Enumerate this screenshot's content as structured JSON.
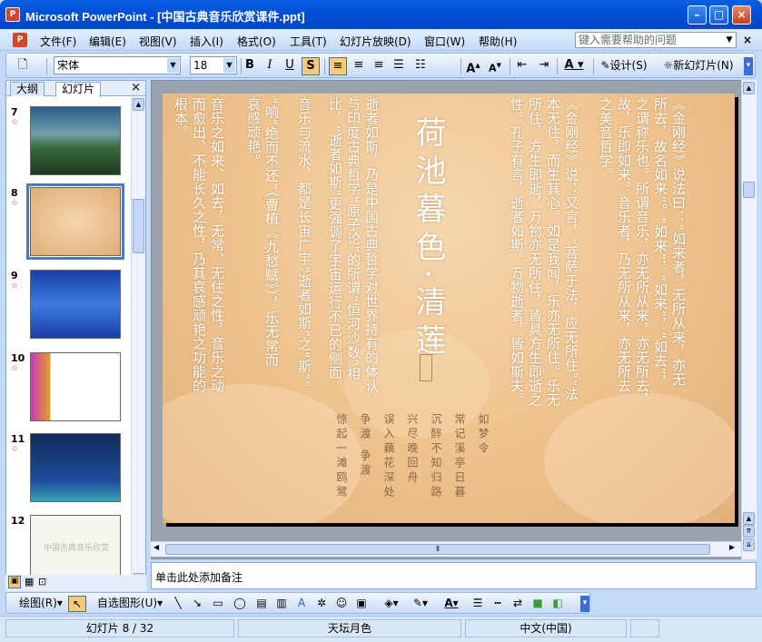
{
  "window": {
    "title": "Microsoft PowerPoint - [中国古典音乐欣赏课件.ppt]",
    "minimize": "–",
    "maximize": "□",
    "close": "×"
  },
  "menu": {
    "items": [
      "文件(F)",
      "编辑(E)",
      "视图(V)",
      "插入(I)",
      "格式(O)",
      "工具(T)",
      "幻灯片放映(D)",
      "窗口(W)",
      "帮助(H)"
    ],
    "help_placeholder": "键入需要帮助的问题"
  },
  "toolbar": {
    "font": "宋体",
    "size": "18",
    "bold": "B",
    "italic": "I",
    "underline": "U",
    "shadow": "S",
    "design": "设计(S)",
    "new_slide": "新幻灯片(N)"
  },
  "panel": {
    "tab_outline": "大纲",
    "tab_slides": "幻灯片",
    "close": "×",
    "slides": [
      {
        "num": "7"
      },
      {
        "num": "8",
        "selected": true
      },
      {
        "num": "9"
      },
      {
        "num": "10"
      },
      {
        "num": "11"
      },
      {
        "num": "12",
        "title": "中国古典音乐欣赏"
      }
    ]
  },
  "slide": {
    "heading": "荷池暮色·清莲",
    "columns": [
      "《金刚经》说法曰：“如来者，无所从来，亦无",
      "所去，故名如来”。“如来”，“如来”，“如去”，",
      "之谓称乐也。所谓音乐，亦无所从来，亦无所去，",
      "故，乐即如来。音乐者，乃无所从来，亦无所去",
      "之美音哲学。",
      "《金刚经》说：又言，“菩萨于法，应无所住。”法",
      "本无住，而生其心。如是我闻，乐亦无所住。乐无",
      "所住，方生即逝，万物亦无所住，皆具方生即逝之",
      "性。孔子有言，逝者如斯。万物逝者，皆如斯夫。",
      "逝者如斯，乃是中国古典哲学对世界持有的体认。",
      "与印度古典哲学“原子论”的所谓“恒河沙数”相",
      "比，“逝者如斯”更强调了宇宙运行不已的侧面。",
      "音乐与流水，都是长宙广宇“逝者如斯”之“斯”。",
      "“响”绝而不还”（曹植《九愁赋》），乐无常而",
      "哀感顽艳。",
      "音乐之如来、如去，无常、无住之性，音乐之动",
      "而愈出、不能长久之性，乃其哀感顽艳之功能的",
      "根本。"
    ],
    "poem": [
      "如梦令",
      "常记溪亭日暮",
      "沉醉不知归路",
      "兴尽晚回舟",
      "误入藕花深处",
      "争渡 争渡",
      "惊起一滩鸥鹭"
    ]
  },
  "notes": "单击此处添加备注",
  "drawbar": {
    "draw": "绘图(R)",
    "autoshapes": "自选图形(U)"
  },
  "status": {
    "slide": "幻灯片 8 / 32",
    "design": "天坛月色",
    "language": "中文(中国)"
  }
}
